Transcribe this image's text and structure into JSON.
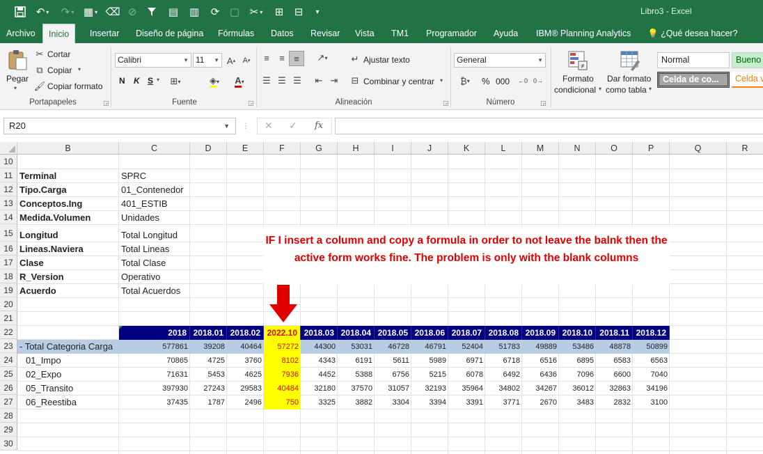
{
  "titlebar": {
    "doc_title": "Libro3  -  Excel"
  },
  "tabs": [
    "Archivo",
    "Inicio",
    "Insertar",
    "Diseño de página",
    "Fórmulas",
    "Datos",
    "Revisar",
    "Vista",
    "TM1",
    "Programador",
    "Ayuda",
    "IBM® Planning Analytics",
    "¿Qué desea hacer?"
  ],
  "ribbon": {
    "clipboard": {
      "paste": "Pegar",
      "cut": "Cortar",
      "copy": "Copiar",
      "format_painter": "Copiar formato",
      "label": "Portapapeles"
    },
    "font": {
      "name": "Calibri",
      "size": "11",
      "bold": "N",
      "italic": "K",
      "underline": "S",
      "label": "Fuente"
    },
    "alignment": {
      "wrap": "Ajustar texto",
      "merge": "Combinar y centrar",
      "label": "Alineación"
    },
    "number": {
      "format": "General",
      "percent": "%",
      "thousands": "000",
      "label": "Número"
    },
    "styles": {
      "cond_format_1": "Formato",
      "cond_format_2": "condicional",
      "table_format_1": "Dar formato",
      "table_format_2": "como tabla",
      "normal": "Normal",
      "bueno": "Bueno",
      "celda_de": "Celda de co...",
      "celda_v": "Celda v"
    }
  },
  "formula_bar": {
    "name_box": "R20",
    "formula": ""
  },
  "columns": [
    "B",
    "C",
    "D",
    "E",
    "F",
    "G",
    "H",
    "I",
    "J",
    "K",
    "L",
    "M",
    "N",
    "O",
    "P",
    "Q",
    "R"
  ],
  "rows": [
    "10",
    "11",
    "12",
    "13",
    "14",
    "15",
    "16",
    "17",
    "18",
    "19",
    "20",
    "21",
    "22",
    "23",
    "24",
    "25",
    "26",
    "27",
    "28",
    "29",
    "30"
  ],
  "dimensions": [
    {
      "label": "Terminal",
      "value": "SPRC"
    },
    {
      "label": "Tipo.Carga",
      "value": "01_Contenedor"
    },
    {
      "label": "Conceptos.Ing",
      "value": "401_ESTIB"
    },
    {
      "label": "Medida.Volumen",
      "value": "Unidades"
    },
    {
      "label": "Longitud",
      "value": "Total Longitud"
    },
    {
      "label": "Lineas.Naviera",
      "value": "Total Lineas"
    },
    {
      "label": "Clase",
      "value": "Total Clase"
    },
    {
      "label": "R_Version",
      "value": "Operativo"
    },
    {
      "label": "Acuerdo",
      "value": "Total Acuerdos"
    }
  ],
  "table": {
    "headers": [
      "2018",
      "2018.01",
      "2018.02",
      "2022.10",
      "2018.03",
      "2018.04",
      "2018.05",
      "2018.06",
      "2018.07",
      "2018.08",
      "2018.09",
      "2018.10",
      "2018.11",
      "2018.12"
    ],
    "rows": [
      {
        "label": "- Total Categoria Carga",
        "values": [
          "577861",
          "39208",
          "40464",
          "57272",
          "44300",
          "53031",
          "46728",
          "46791",
          "52404",
          "51783",
          "49889",
          "53486",
          "48878",
          "50899"
        ]
      },
      {
        "label": "01_Impo",
        "values": [
          "70865",
          "4725",
          "3760",
          "8102",
          "4343",
          "6191",
          "5611",
          "5989",
          "6971",
          "6718",
          "6516",
          "6895",
          "6583",
          "6563"
        ]
      },
      {
        "label": "02_Expo",
        "values": [
          "71631",
          "5453",
          "4625",
          "7936",
          "4452",
          "5388",
          "6756",
          "5215",
          "6078",
          "6492",
          "6436",
          "7096",
          "6600",
          "7040"
        ]
      },
      {
        "label": "05_Transito",
        "values": [
          "397930",
          "27243",
          "29583",
          "40484",
          "32180",
          "37570",
          "31057",
          "32193",
          "35964",
          "34802",
          "34267",
          "36012",
          "32863",
          "34196"
        ]
      },
      {
        "label": "06_Reestiba",
        "values": [
          "37435",
          "1787",
          "2496",
          "750",
          "3325",
          "3882",
          "3304",
          "3394",
          "3391",
          "3771",
          "2670",
          "3483",
          "2832",
          "3100"
        ]
      }
    ]
  },
  "annotation": {
    "text": "IF I insert a column and copy a formula in order to not leave the balnk then the active form works fine. The problem is only with the blank columns",
    "color": "#e10000"
  },
  "colors": {
    "excel_green": "#217346",
    "header_navy": "#000080",
    "highlight_yellow": "#ffff00",
    "total_row_blue": "#b8cce4"
  }
}
